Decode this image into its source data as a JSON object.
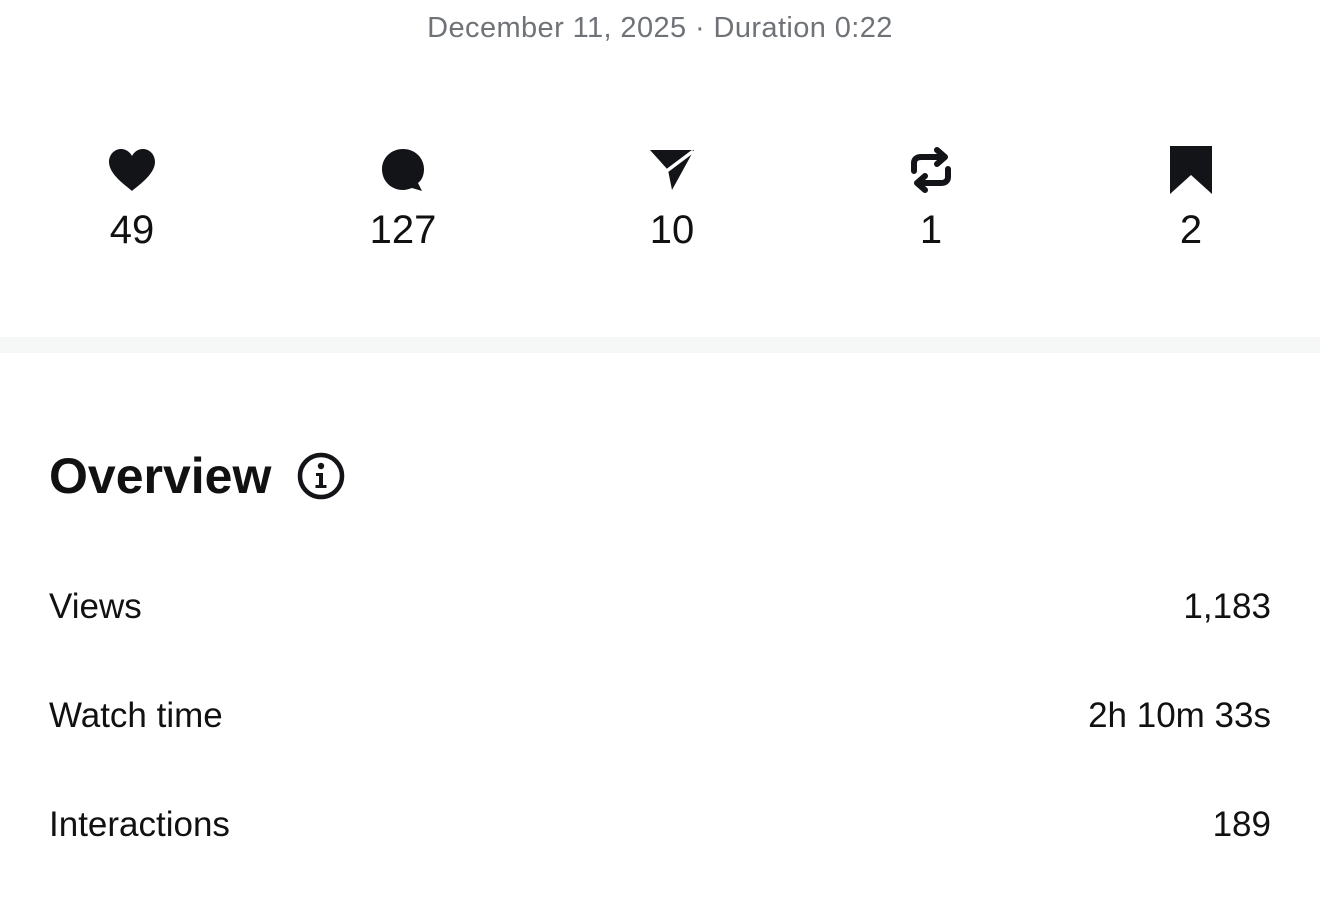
{
  "header": {
    "date_duration": "December 11, 2025 · Duration 0:22"
  },
  "stats": [
    {
      "icon": "heart-icon",
      "count": "49"
    },
    {
      "icon": "comment-icon",
      "count": "127"
    },
    {
      "icon": "send-icon",
      "count": "10"
    },
    {
      "icon": "repost-icon",
      "count": "1"
    },
    {
      "icon": "bookmark-icon",
      "count": "2"
    }
  ],
  "overview": {
    "title": "Overview",
    "info_icon": "info-icon",
    "metrics": [
      {
        "label": "Views",
        "value": "1,183"
      },
      {
        "label": "Watch time",
        "value": "2h 10m 33s"
      },
      {
        "label": "Interactions",
        "value": "189"
      }
    ]
  },
  "colors": {
    "text": "#111111",
    "muted": "#6f7378",
    "divider": "#f6f7f7",
    "icon": "#121418"
  }
}
